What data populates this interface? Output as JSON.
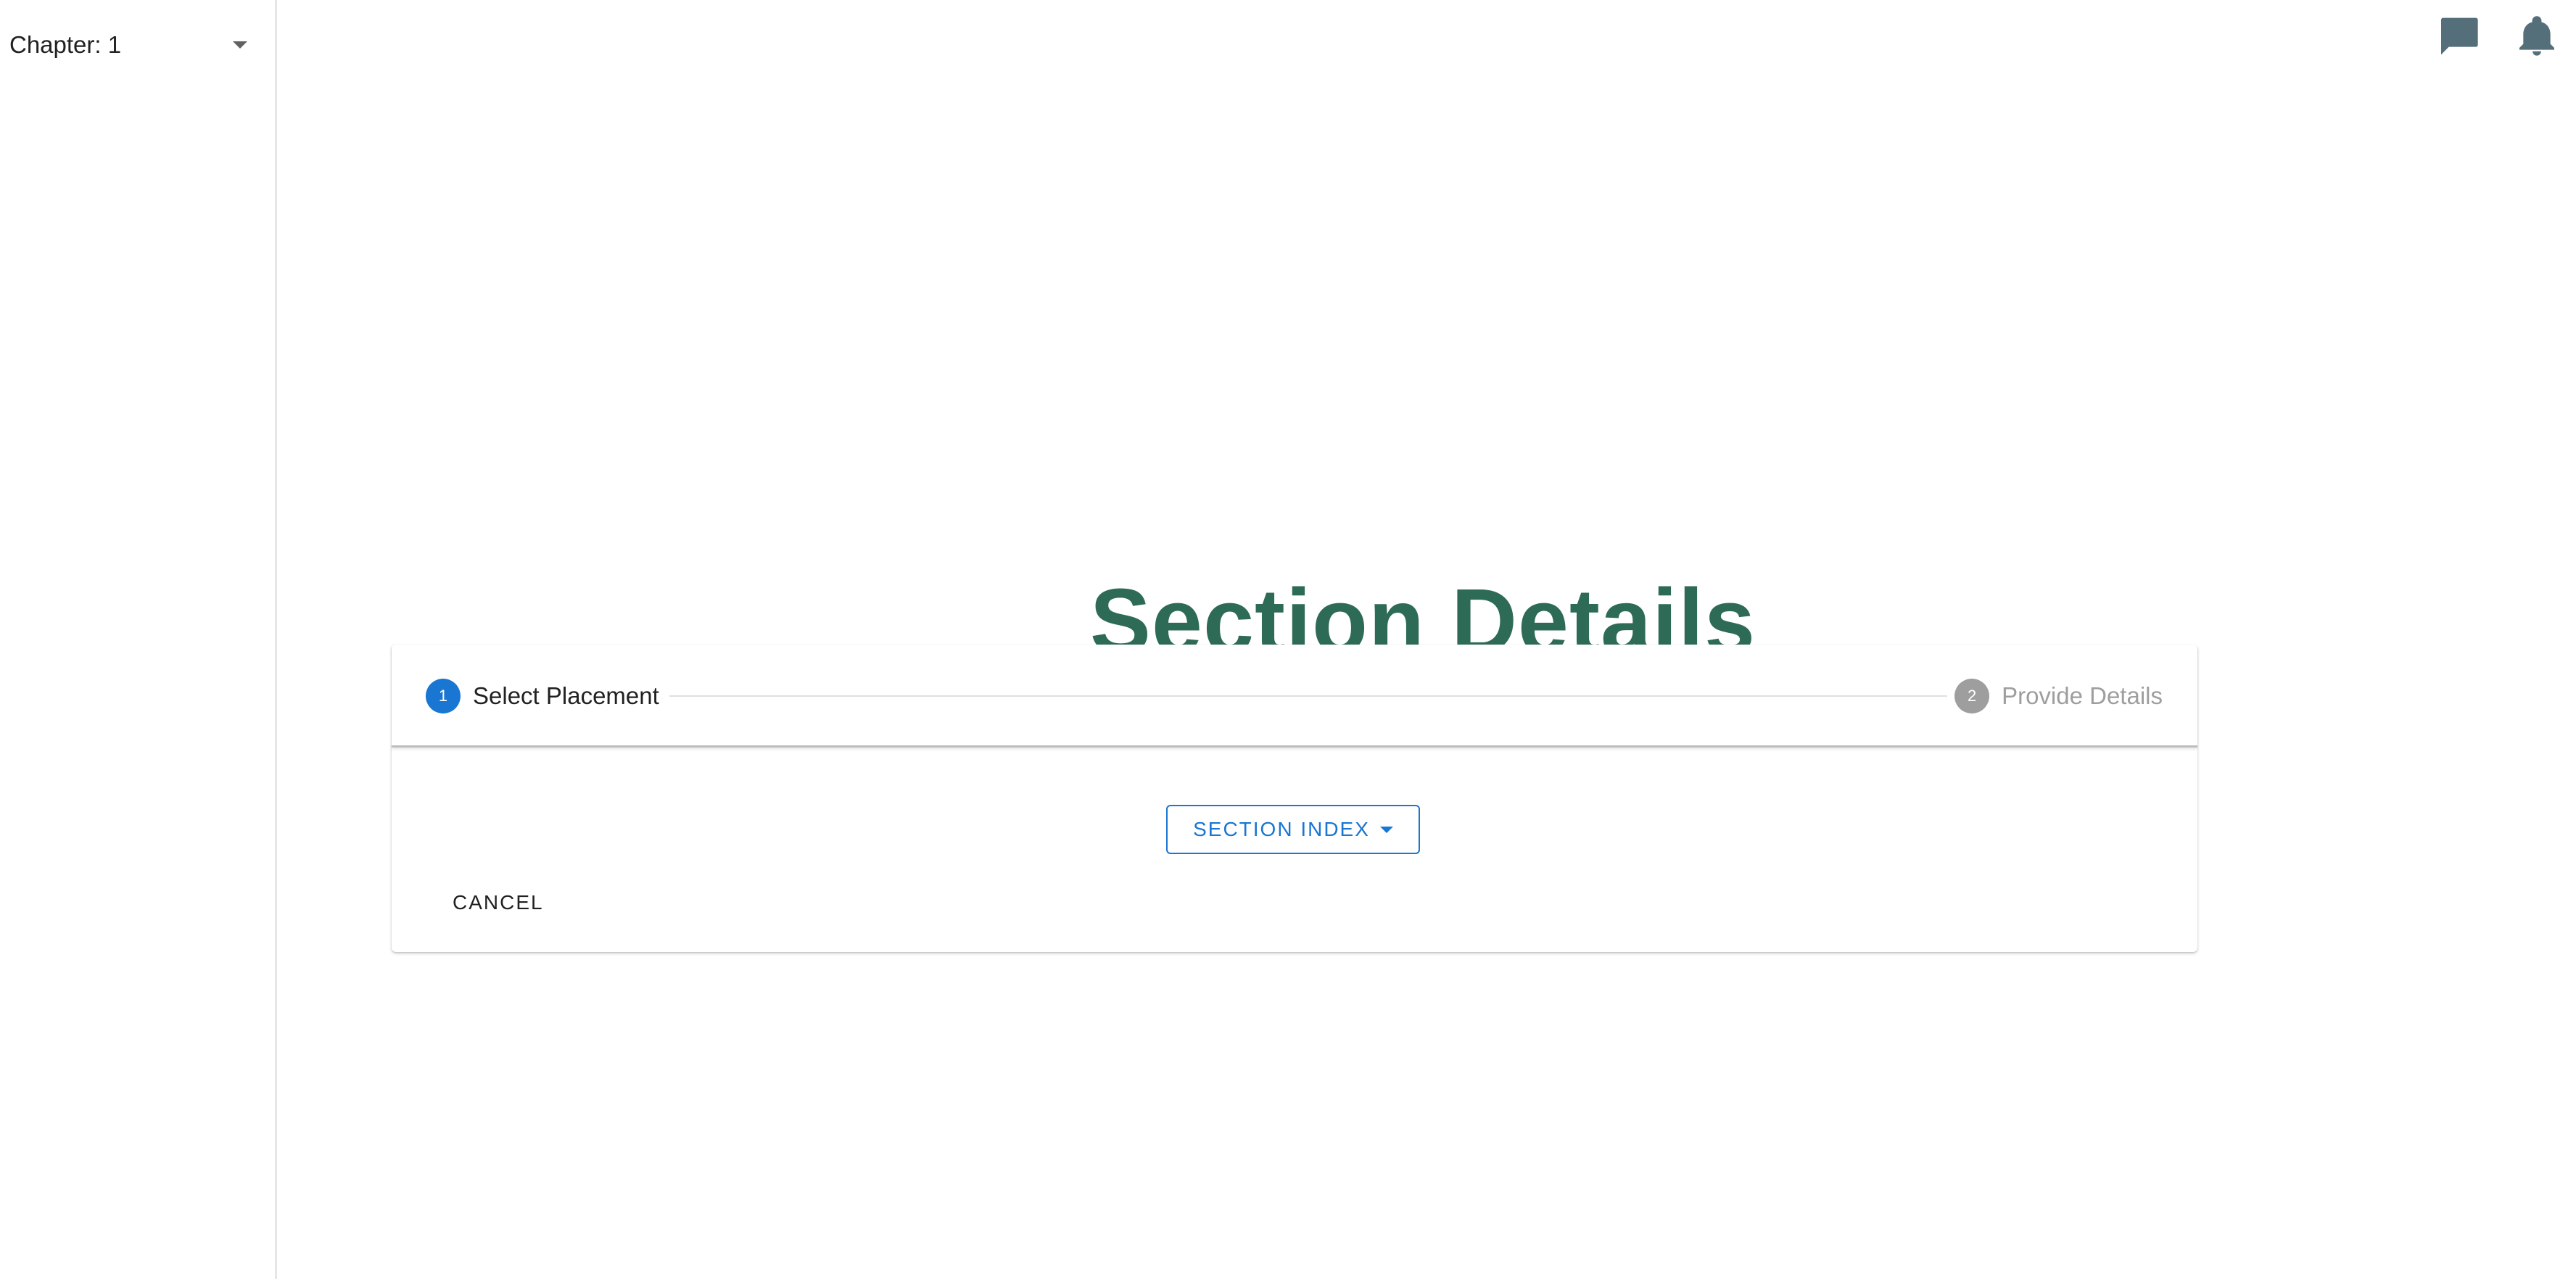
{
  "sidebar": {
    "chapter_select": {
      "value": "Chapter: 1",
      "icon": "chevron-down-icon"
    }
  },
  "header": {
    "icons": [
      "chat-icon",
      "bell-icon"
    ]
  },
  "main": {
    "title": "Section Details",
    "stepper": {
      "steps": [
        {
          "number": "1",
          "label": "Select Placement",
          "state": "active"
        },
        {
          "number": "2",
          "label": "Provide Details",
          "state": "inactive"
        }
      ]
    },
    "section_index_button": "SECTION INDEX",
    "cancel_button": "CANCEL"
  },
  "colors": {
    "title": "#2e6b57",
    "accent": "#1976d2",
    "inactive": "#9e9e9e",
    "icon": "#546e7a"
  }
}
